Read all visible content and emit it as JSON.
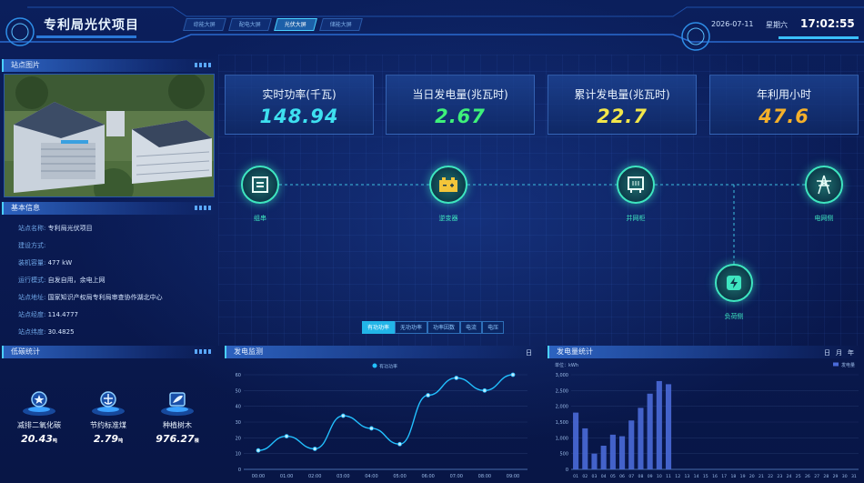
{
  "header": {
    "title": "专利局光伏项目",
    "tabs": [
      {
        "label": "综能大屏",
        "active": false
      },
      {
        "label": "配电大屏",
        "active": false
      },
      {
        "label": "光伏大屏",
        "active": true
      },
      {
        "label": "储能大屏",
        "active": false
      }
    ],
    "date": "2026-07-11",
    "weekday": "星期六",
    "time": "17:02:55"
  },
  "site_photo": {
    "title": "站点图片"
  },
  "basic_info": {
    "title": "基本信息",
    "rows": [
      {
        "key": "站点名称:",
        "value": "专利局光伏项目"
      },
      {
        "key": "建设方式:",
        "value": ""
      },
      {
        "key": "装机容量:",
        "value": "477 kW"
      },
      {
        "key": "运行模式:",
        "value": "自发自用，余电上网"
      },
      {
        "key": "站点地址:",
        "value": "国家知识产权局专利局审查协作湖北中心"
      },
      {
        "key": "站点经度:",
        "value": "114.4777"
      },
      {
        "key": "站点纬度:",
        "value": "30.4825"
      }
    ]
  },
  "kpis": [
    {
      "label": "实时功率(千瓦)",
      "value": "148.94",
      "color": "#3ee0f0"
    },
    {
      "label": "当日发电量(兆瓦时)",
      "value": "2.67",
      "color": "#3ef07a"
    },
    {
      "label": "累计发电量(兆瓦时)",
      "value": "22.7",
      "color": "#f2e64a"
    },
    {
      "label": "年利用小时",
      "value": "47.6",
      "color": "#f5b02a"
    }
  ],
  "flow": {
    "nodes": [
      {
        "label": "组串",
        "icon": "string-panel-icon"
      },
      {
        "label": "逆变器",
        "icon": "inverter-battery-icon"
      },
      {
        "label": "并网柜",
        "icon": "cabinet-icon"
      },
      {
        "label": "电网侧",
        "icon": "power-tower-icon"
      },
      {
        "label": "负荷侧",
        "icon": "load-bolt-icon"
      }
    ]
  },
  "monitor_tabs": [
    {
      "label": "有功功率",
      "active": true
    },
    {
      "label": "无功功率",
      "active": false
    },
    {
      "label": "功率因数",
      "active": false
    },
    {
      "label": "电流",
      "active": false
    },
    {
      "label": "电压",
      "active": false
    }
  ],
  "carbon": {
    "title": "低碳统计",
    "items": [
      {
        "label": "减排二氧化碳",
        "value": "20.43",
        "unit": "吨",
        "icon": "co2-badge-icon"
      },
      {
        "label": "节约标准煤",
        "value": "2.79",
        "unit": "吨",
        "icon": "coal-badge-icon"
      },
      {
        "label": "种植树木",
        "value": "976.27",
        "unit": "棵",
        "icon": "tree-badge-icon"
      }
    ]
  },
  "monitor_chart": {
    "title": "发电监测",
    "range_label": "日"
  },
  "generation_chart": {
    "title": "发电量统计",
    "ranges": [
      "日",
      "月",
      "年"
    ]
  },
  "chart_data": [
    {
      "type": "line",
      "legend": "有功功率",
      "x": [
        "00:00",
        "01:00",
        "02:00",
        "03:00",
        "04:00",
        "05:00",
        "06:00",
        "07:00",
        "08:00",
        "09:00"
      ],
      "values": [
        12,
        21,
        13,
        34,
        26,
        16,
        47,
        58,
        50,
        60
      ],
      "yticks": [
        0,
        10,
        20,
        30,
        40,
        50,
        60
      ],
      "ylim": [
        0,
        60
      ],
      "color": "#22c0ff"
    },
    {
      "type": "bar",
      "unit_label": "单位：kWh",
      "legend": "发电量",
      "categories": [
        "01",
        "02",
        "03",
        "04",
        "05",
        "06",
        "07",
        "08",
        "09",
        "10",
        "11",
        "12",
        "13",
        "14",
        "15",
        "16",
        "17",
        "18",
        "19",
        "20",
        "21",
        "22",
        "23",
        "24",
        "25",
        "26",
        "27",
        "28",
        "29",
        "30",
        "31"
      ],
      "values": [
        1800,
        1300,
        500,
        750,
        1100,
        1050,
        1550,
        1950,
        2400,
        2800,
        2700,
        0,
        0,
        0,
        0,
        0,
        0,
        0,
        0,
        0,
        0,
        0,
        0,
        0,
        0,
        0,
        0,
        0,
        0,
        0,
        0
      ],
      "yticks": [
        "0",
        "500",
        "1,000",
        "1,500",
        "2,000",
        "2,500",
        "3,000"
      ],
      "ylim": [
        0,
        3000
      ],
      "color": "#4a6ad8"
    }
  ]
}
